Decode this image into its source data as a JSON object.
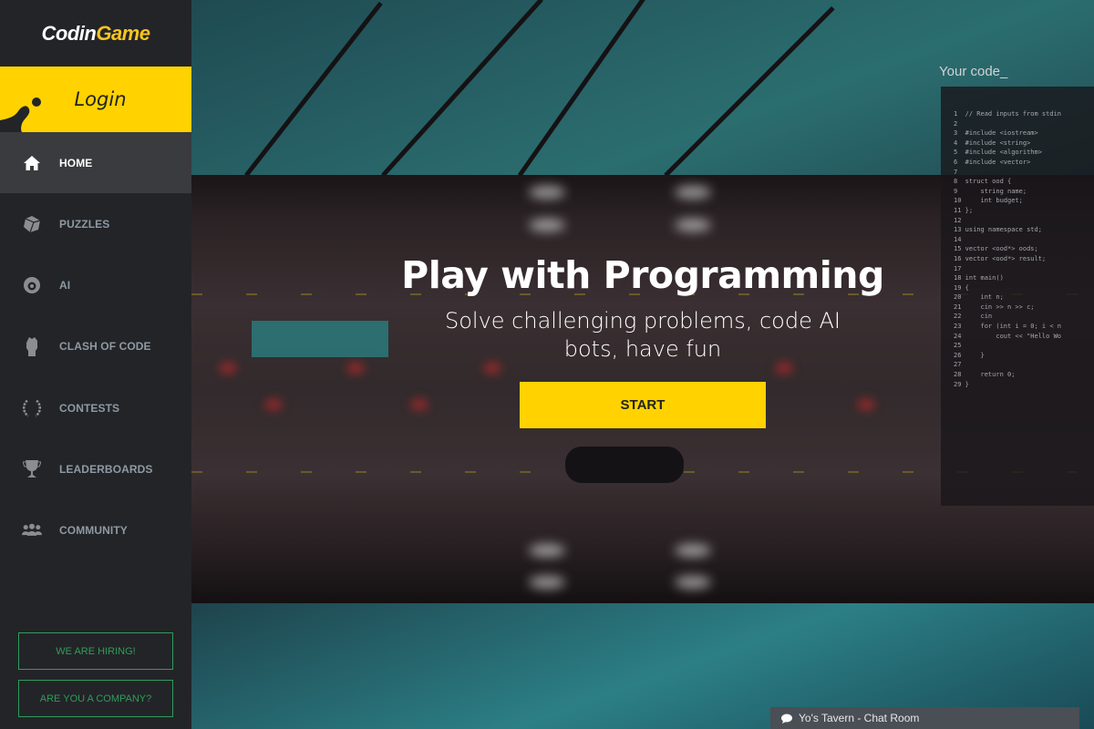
{
  "brand": {
    "logo_part1": "Codin",
    "logo_part2": "Game",
    "accent": "#ffd200",
    "hiring_color": "#2f9c5b"
  },
  "sidebar": {
    "login_label": "Login",
    "items": [
      {
        "label": "HOME",
        "icon": "home-icon",
        "active": true
      },
      {
        "label": "PUZZLES",
        "icon": "cube-icon"
      },
      {
        "label": "AI",
        "icon": "ai-icon"
      },
      {
        "label": "CLASH OF CODE",
        "icon": "fist-icon"
      },
      {
        "label": "CONTESTS",
        "icon": "laurel-icon"
      },
      {
        "label": "LEADERBOARDS",
        "icon": "trophy-icon"
      },
      {
        "label": "COMMUNITY",
        "icon": "community-icon"
      }
    ],
    "hiring_label": "WE ARE HIRING!",
    "company_label": "ARE YOU A COMPANY?"
  },
  "hero": {
    "title": "Play with Programming",
    "subtitle": "Solve challenging problems, code AI bots, have fun",
    "start_label": "START",
    "code_title": "Your code_",
    "code_lines": "1  // Read inputs from stdin\n2\n3  #include <iostream>\n4  #include <string>\n5  #include <algorithm>\n6  #include <vector>\n7\n8  struct ood {\n9      string name;\n10     int budget;\n11 };\n12\n13 using namespace std;\n14\n15 vector <ood*> oods;\n16 vector <ood*> result;\n17\n18 int main()\n19 {\n20     int n;\n21     cin >> n >> c;\n22     cin\n23     for (int i = 0; i < n\n24         cout << \"Hello Wo\n25\n26     }\n27\n28     return 0;\n29 }"
  },
  "chat": {
    "label": "Yo's Tavern - Chat Room",
    "icon": "chat-bubble-icon"
  }
}
